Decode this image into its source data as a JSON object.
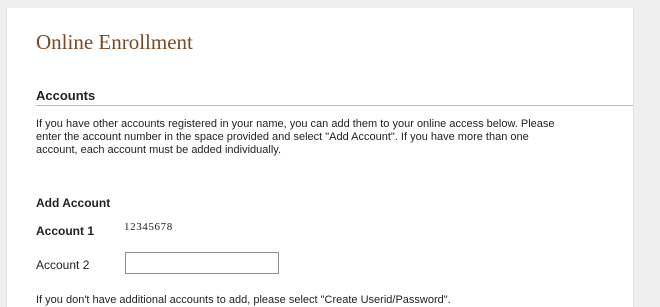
{
  "page": {
    "title": "Online Enrollment"
  },
  "accounts_section": {
    "heading": "Accounts",
    "intro_lines": [
      "If you have other accounts registered in your name, you can add them to your online access below. Please",
      "enter the account number in the space provided and select \"Add Account\". If you have more than one",
      "account, each account must be added individually."
    ]
  },
  "add_account": {
    "heading": "Add Account",
    "account1": {
      "label": "Account 1",
      "value": "12345678"
    },
    "account2": {
      "label": "Account 2",
      "value": "",
      "placeholder": ""
    }
  },
  "footer": {
    "note": "If you don't have additional accounts to add, please select \"Create Userid/Password\"."
  },
  "colors": {
    "title": "#7a4a24",
    "text": "#222222",
    "divider": "#b8b8b8",
    "background": "#efefef",
    "card": "#ffffff"
  }
}
